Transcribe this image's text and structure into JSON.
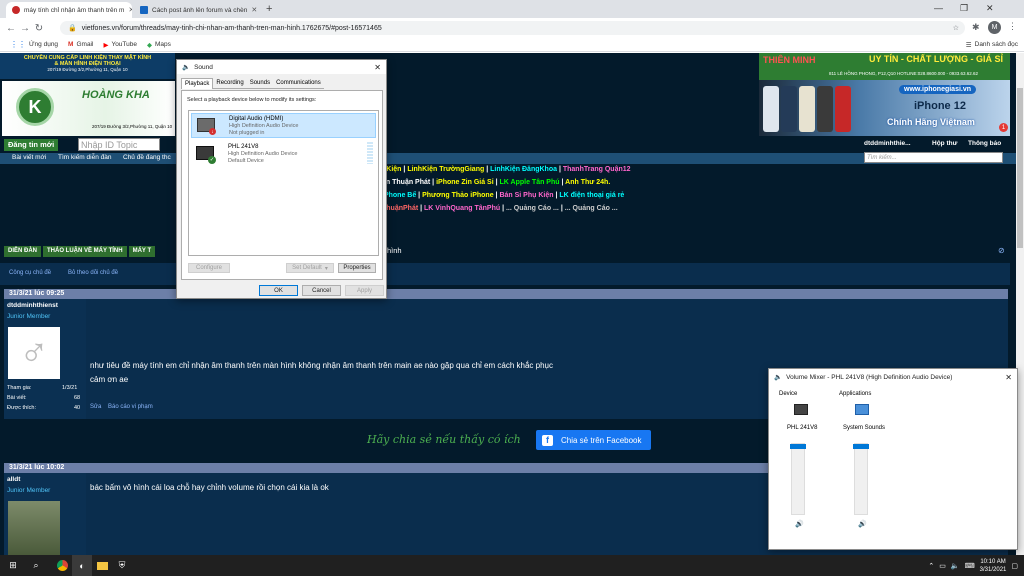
{
  "browser": {
    "tabs": [
      {
        "title": "máy tính chỉ nhận âm thanh trên m",
        "color": "#c62828"
      },
      {
        "title": "Cách post ảnh lên forum và chèn",
        "color": "#1565c0"
      }
    ],
    "url": "vietfones.vn/forum/threads/may-tinh-chi-nhan-am-thanh-tren-man-hinh.1762675/#post-16571465",
    "profile": "M",
    "bookmarks": [
      "Ứng dụng",
      "Gmail",
      "YouTube",
      "Maps"
    ],
    "reading_list": "Danh sách đọc"
  },
  "site": {
    "ad_left_line1": "CHUYÊN CUNG CẤP LINH KIỆN THAY MẶT KÍNH",
    "ad_left_line2": "& MÀN HÌNH ĐIỆN THOẠI",
    "ad_left_addr": "207/19 Đường 3/2,Phường 11, Quận 10",
    "ad_left_phone": "0973 36 36 36 - 0917 06 06 06",
    "ad_brand": "HOÀNG KHA",
    "ad_brand_sub": "HOÀNG KHA",
    "ad_brand_addr": "207/19 Đường 3/2,Phường 11, Quận 10",
    "ad_right_top": "UY TÍN - CHẤT LƯỢNG - GIÁ SỈ",
    "ad_right_top_left": "THIÊN MINH",
    "ad_right_addr": "811 LÊ HỒNG PHONG, P12,Q10   HOTLINE:028.8600.000 - 0933.63.62.62",
    "ad_right_site": "www.iphonegiasi.vn",
    "ad_right_model": "iPhone 12",
    "ad_right_slogan": "Chính Hãng Việtnam",
    "btn_post_new": "Đăng tin mới",
    "search_id_placeholder": "Nhập ID Topic",
    "nav_links": [
      "Bài viết mới",
      "Tìm kiếm diễn đàn",
      "Chủ đề đang thc"
    ],
    "user_name": "dtddminhthie...",
    "nav_inbox": "Hộp thư",
    "nav_alerts": "Thông báo",
    "alerts_count": "1",
    "search_placeholder": "Tìm kiếm...",
    "link_rows": [
      [
        {
          "t": "nKiện",
          "c": "#ffff00"
        },
        {
          "t": "LinhKiện TrườngGiang",
          "c": "#ffff00"
        },
        {
          "t": "LinhKiện ĐăngKhoa",
          "c": "#00ffff"
        },
        {
          "t": "ThanhTrang Quận12",
          "c": "#ff66cc"
        }
      ],
      [
        {
          "t": "ện Thuận Phát",
          "c": "#ffffff"
        },
        {
          "t": "iPhone Zin Giá Sỉ",
          "c": "#ffff00"
        },
        {
          "t": "LK Apple Tân Phú",
          "c": "#00ff00"
        },
        {
          "t": "Anh Thư 24h.",
          "c": "#ffff00"
        }
      ],
      [
        {
          "t": "iPhone Bể",
          "c": "#00ffff"
        },
        {
          "t": "Phương Thảo iPhone",
          "c": "#ffff00"
        },
        {
          "t": "Bán Sỉ Phụ Kiện",
          "c": "#ff66cc"
        },
        {
          "t": "LK điện thoại giá rẻ",
          "c": "#00ffff"
        }
      ],
      [
        {
          "t": "ThuậnPhát",
          "c": "#ff6666"
        },
        {
          "t": "LK VinhQuang TânPhú",
          "c": "#ff66cc"
        },
        {
          "t": "... Quảng Cáo ...",
          "c": "#cccccc"
        },
        {
          "t": "... Quảng Cáo ...",
          "c": "#cccccc"
        }
      ]
    ],
    "breadcrumb": [
      "DIỄN ĐÀN",
      "THẢO LUẬN VỀ MÁY TÍNH",
      "MÁY T"
    ],
    "thread_title_tail": "hình",
    "thread_tools": [
      "Công cụ chủ đề",
      "Bỏ theo dõi chủ đề"
    ],
    "share_text": "Hãy chia sẻ nếu thấy có ích",
    "share_button": "Chia sẻ trên Facebook",
    "posts": [
      {
        "date": "31/3/21 lúc 09:25",
        "user": "dtddminhthienst",
        "role": "Junior Member",
        "joined_label": "Tham gia:",
        "joined": "1/3/21",
        "posts_label": "Bài viết:",
        "posts": "68",
        "likes_label": "Được thích:",
        "likes": "40",
        "body1": "như tiêu đề máy tính em chỉ nhận âm thanh trên màn hình không nhận âm thanh trên main ae nào gặp qua chỉ em cách khắc phục",
        "body2": "cảm ơn ae",
        "edit": "Sửa",
        "report": "Báo cáo vi phạm"
      },
      {
        "date": "31/3/21 lúc 10:02",
        "user": "alldt",
        "role": "Junior Member",
        "body1": "bác bấm vô hình cái loa chỗ hay chỉnh volume rồi chọn cái kia là ok"
      }
    ]
  },
  "sound_dialog": {
    "title": "Sound",
    "tabs": [
      "Playback",
      "Recording",
      "Sounds",
      "Communications"
    ],
    "instruction": "Select a playback device below to modify its settings:",
    "devices": [
      {
        "name": "Digital Audio (HDMI)",
        "desc": "High Definition Audio Device",
        "status": "Not plugged in"
      },
      {
        "name": "PHL 241V8",
        "desc": "High Definition Audio Device",
        "status": "Default Device"
      }
    ],
    "configure": "Configure",
    "set_default": "Set Default",
    "properties": "Properties",
    "ok": "OK",
    "cancel": "Cancel",
    "apply": "Apply"
  },
  "mixer": {
    "title": "Volume Mixer - PHL 241V8 (High Definition Audio Device)",
    "device_label": "Device",
    "apps_label": "Applications",
    "device_name": "PHL 241V8",
    "app_name": "System Sounds",
    "device_level": 1.0,
    "app_level": 1.0
  },
  "taskbar": {
    "time": "10:10 AM",
    "date": "3/31/2021"
  }
}
